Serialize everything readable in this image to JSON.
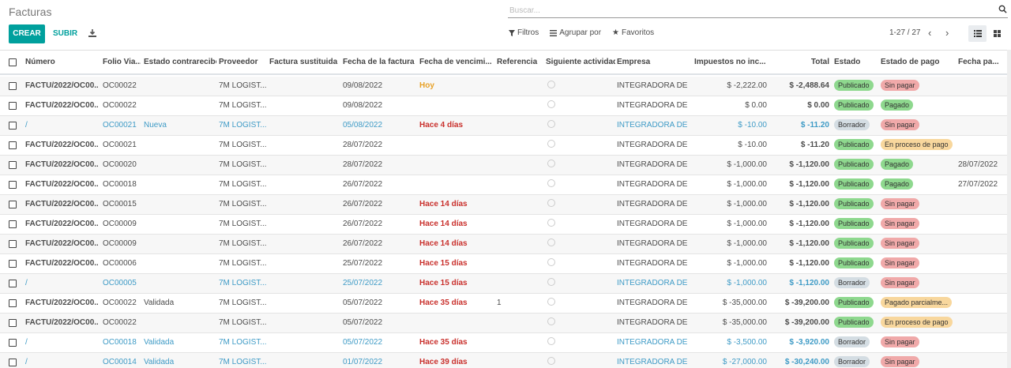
{
  "breadcrumb": "Facturas",
  "search": {
    "placeholder": "Buscar..."
  },
  "toolbar": {
    "create_label": "CREAR",
    "upload_label": "SUBIR"
  },
  "filters": {
    "filters_label": "Filtros",
    "group_by_label": "Agrupar por",
    "favorites_label": "Favoritos"
  },
  "pager": {
    "value": "1-27 / 27"
  },
  "columns": {
    "number": "Número",
    "folio": "Folio Via...",
    "receipt_state": "Estado contrarecibo",
    "supplier": "Proveedor",
    "replaced": "Factura sustituida",
    "invoice_date": "Fecha de la factura",
    "due_date": "Fecha de vencimi...",
    "reference": "Referencia",
    "next_activity": "Siguiente actividad",
    "company": "Empresa",
    "tax_excluded": "Impuestos no inc...",
    "total": "Total",
    "state": "Estado",
    "payment_state": "Estado de pago",
    "payment_date": "Fecha pa..."
  },
  "rows": [
    {
      "number": "FACTU/2022/OC00...",
      "folio": "OC00022",
      "receipt_state": "",
      "supplier": "7M LOGIST...",
      "invoice_date": "09/08/2022",
      "due_date": "Hoy",
      "reference": "",
      "company": "INTEGRADORA DE ...",
      "tax_excluded": "$ -2,222.00",
      "total": "$ -2,488.64",
      "state": "Publicado",
      "payment_state": "Sin pagar",
      "payment_date": ""
    },
    {
      "number": "FACTU/2022/OC00...",
      "folio": "OC00022",
      "receipt_state": "",
      "supplier": "7M LOGIST...",
      "invoice_date": "09/08/2022",
      "due_date": "",
      "reference": "",
      "company": "INTEGRADORA DE ...",
      "tax_excluded": "$ 0.00",
      "total": "$ 0.00",
      "state": "Publicado",
      "payment_state": "Pagado",
      "payment_date": ""
    },
    {
      "number": "/",
      "folio": "OC00021",
      "receipt_state": "Nueva",
      "supplier": "7M LOGIST...",
      "invoice_date": "05/08/2022",
      "due_date": "Hace 4 días",
      "reference": "",
      "company": "INTEGRADORA DE ...",
      "tax_excluded": "$ -10.00",
      "total": "$ -11.20",
      "state": "Borrador",
      "payment_state": "Sin pagar",
      "payment_date": ""
    },
    {
      "number": "FACTU/2022/OC00...",
      "folio": "OC00021",
      "receipt_state": "",
      "supplier": "7M LOGIST...",
      "invoice_date": "28/07/2022",
      "due_date": "",
      "reference": "",
      "company": "INTEGRADORA DE ...",
      "tax_excluded": "$ -10.00",
      "total": "$ -11.20",
      "state": "Publicado",
      "payment_state": "En proceso de pago",
      "payment_date": ""
    },
    {
      "number": "FACTU/2022/OC00...",
      "folio": "OC00020",
      "receipt_state": "",
      "supplier": "7M LOGIST...",
      "invoice_date": "28/07/2022",
      "due_date": "",
      "reference": "",
      "company": "INTEGRADORA DE ...",
      "tax_excluded": "$ -1,000.00",
      "total": "$ -1,120.00",
      "state": "Publicado",
      "payment_state": "Pagado",
      "payment_date": "28/07/2022"
    },
    {
      "number": "FACTU/2022/OC00...",
      "folio": "OC00018",
      "receipt_state": "",
      "supplier": "7M LOGIST...",
      "invoice_date": "26/07/2022",
      "due_date": "",
      "reference": "",
      "company": "INTEGRADORA DE ...",
      "tax_excluded": "$ -1,000.00",
      "total": "$ -1,120.00",
      "state": "Publicado",
      "payment_state": "Pagado",
      "payment_date": "27/07/2022"
    },
    {
      "number": "FACTU/2022/OC00...",
      "folio": "OC00015",
      "receipt_state": "",
      "supplier": "7M LOGIST...",
      "invoice_date": "26/07/2022",
      "due_date": "Hace 14 días",
      "reference": "",
      "company": "INTEGRADORA DE ...",
      "tax_excluded": "$ -1,000.00",
      "total": "$ -1,120.00",
      "state": "Publicado",
      "payment_state": "Sin pagar",
      "payment_date": ""
    },
    {
      "number": "FACTU/2022/OC00...",
      "folio": "OC00009",
      "receipt_state": "",
      "supplier": "7M LOGIST...",
      "invoice_date": "26/07/2022",
      "due_date": "Hace 14 días",
      "reference": "",
      "company": "INTEGRADORA DE ...",
      "tax_excluded": "$ -1,000.00",
      "total": "$ -1,120.00",
      "state": "Publicado",
      "payment_state": "Sin pagar",
      "payment_date": ""
    },
    {
      "number": "FACTU/2022/OC00...",
      "folio": "OC00009",
      "receipt_state": "",
      "supplier": "7M LOGIST...",
      "invoice_date": "26/07/2022",
      "due_date": "Hace 14 días",
      "reference": "",
      "company": "INTEGRADORA DE ...",
      "tax_excluded": "$ -1,000.00",
      "total": "$ -1,120.00",
      "state": "Publicado",
      "payment_state": "Sin pagar",
      "payment_date": ""
    },
    {
      "number": "FACTU/2022/OC00...",
      "folio": "OC00006",
      "receipt_state": "",
      "supplier": "7M LOGIST...",
      "invoice_date": "25/07/2022",
      "due_date": "Hace 15 días",
      "reference": "",
      "company": "INTEGRADORA DE ...",
      "tax_excluded": "$ -1,000.00",
      "total": "$ -1,120.00",
      "state": "Publicado",
      "payment_state": "Sin pagar",
      "payment_date": ""
    },
    {
      "number": "/",
      "folio": "OC00005",
      "receipt_state": "",
      "supplier": "7M LOGIST...",
      "invoice_date": "25/07/2022",
      "due_date": "Hace 15 días",
      "reference": "",
      "company": "INTEGRADORA DE ...",
      "tax_excluded": "$ -1,000.00",
      "total": "$ -1,120.00",
      "state": "Borrador",
      "payment_state": "Sin pagar",
      "payment_date": ""
    },
    {
      "number": "FACTU/2022/OC00...",
      "folio": "OC00022",
      "receipt_state": "Validada",
      "supplier": "7M LOGIST...",
      "invoice_date": "05/07/2022",
      "due_date": "Hace 35 días",
      "reference": "1",
      "company": "INTEGRADORA DE ...",
      "tax_excluded": "$ -35,000.00",
      "total": "$ -39,200.00",
      "state": "Publicado",
      "payment_state": "Pagado parcialme...",
      "payment_date": ""
    },
    {
      "number": "FACTU/2022/OC00...",
      "folio": "OC00022",
      "receipt_state": "",
      "supplier": "7M LOGIST...",
      "invoice_date": "05/07/2022",
      "due_date": "",
      "reference": "",
      "company": "INTEGRADORA DE ...",
      "tax_excluded": "$ -35,000.00",
      "total": "$ -39,200.00",
      "state": "Publicado",
      "payment_state": "En proceso de pago",
      "payment_date": ""
    },
    {
      "number": "/",
      "folio": "OC00018",
      "receipt_state": "Validada",
      "supplier": "7M LOGIST...",
      "invoice_date": "05/07/2022",
      "due_date": "Hace 35 días",
      "reference": "",
      "company": "INTEGRADORA DE ...",
      "tax_excluded": "$ -3,500.00",
      "total": "$ -3,920.00",
      "state": "Borrador",
      "payment_state": "Sin pagar",
      "payment_date": ""
    },
    {
      "number": "/",
      "folio": "OC00014",
      "receipt_state": "Validada",
      "supplier": "7M LOGIST...",
      "invoice_date": "01/07/2022",
      "due_date": "Hace 39 días",
      "reference": "",
      "company": "INTEGRADORA DE ...",
      "tax_excluded": "$ -27,000.00",
      "total": "$ -30,240.00",
      "state": "Borrador",
      "payment_state": "Sin pagar",
      "payment_date": ""
    }
  ]
}
